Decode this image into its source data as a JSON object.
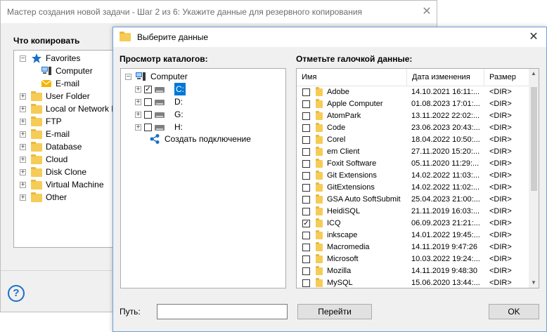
{
  "wizard": {
    "title": "Мастер создания новой задачи - Шаг 2 из 6: Укажите данные для резервного копирования",
    "close_glyph": "✕",
    "section_label": "Что копировать",
    "help_glyph": "?",
    "tree": [
      {
        "label": "Favorites",
        "icon": "star-icon",
        "expander": "−"
      },
      {
        "label": "Computer",
        "icon": "computer-icon"
      },
      {
        "label": "E-mail",
        "icon": "mail-icon"
      },
      {
        "label": "User Folder",
        "icon": "folder-icon",
        "expander": "+"
      },
      {
        "label": "Local or Network D",
        "icon": "folder-icon",
        "expander": "+"
      },
      {
        "label": "FTP",
        "icon": "folder-icon",
        "expander": "+"
      },
      {
        "label": "E-mail",
        "icon": "folder-icon",
        "expander": "+"
      },
      {
        "label": "Database",
        "icon": "folder-icon",
        "expander": "+"
      },
      {
        "label": "Cloud",
        "icon": "folder-icon",
        "expander": "+"
      },
      {
        "label": "Disk Clone",
        "icon": "folder-icon",
        "expander": "+"
      },
      {
        "label": "Virtual Machine",
        "icon": "folder-icon",
        "expander": "+"
      },
      {
        "label": "Other",
        "icon": "folder-icon",
        "expander": "+"
      }
    ]
  },
  "dialog": {
    "title": "Выберите данные",
    "close_glyph": "✕",
    "browse_label": "Просмотр каталогов:",
    "check_label": "Отметьте галочкой данные:",
    "dir_tree": {
      "root": "Computer",
      "drives": [
        {
          "label": "C:",
          "checked": true,
          "selected": true
        },
        {
          "label": "D:",
          "checked": false
        },
        {
          "label": "G:",
          "checked": false
        },
        {
          "label": "H:",
          "checked": false
        }
      ],
      "create_connection": "Создать подключение"
    },
    "columns": {
      "name": "Имя",
      "modified": "Дата изменения",
      "size": "Размер"
    },
    "files": [
      {
        "name": "Adobe",
        "date": "14.10.2021 16:11:...",
        "size": "<DIR>",
        "checked": false
      },
      {
        "name": "Apple Computer",
        "date": "01.08.2023 17:01:...",
        "size": "<DIR>",
        "checked": false
      },
      {
        "name": "AtomPark",
        "date": "13.11.2022 22:02:...",
        "size": "<DIR>",
        "checked": false
      },
      {
        "name": "Code",
        "date": "23.06.2023 20:43:...",
        "size": "<DIR>",
        "checked": false
      },
      {
        "name": "Corel",
        "date": "18.04.2022 10:50:...",
        "size": "<DIR>",
        "checked": false
      },
      {
        "name": "em Client",
        "date": "27.11.2020 15:20:...",
        "size": "<DIR>",
        "checked": false
      },
      {
        "name": "Foxit Software",
        "date": "05.11.2020 11:29:...",
        "size": "<DIR>",
        "checked": false
      },
      {
        "name": "Git Extensions",
        "date": "14.02.2022 11:03:...",
        "size": "<DIR>",
        "checked": false
      },
      {
        "name": "GitExtensions",
        "date": "14.02.2022 11:02:...",
        "size": "<DIR>",
        "checked": false
      },
      {
        "name": "GSA Auto SoftSubmit",
        "date": "25.04.2023 21:00:...",
        "size": "<DIR>",
        "checked": false
      },
      {
        "name": "HeidiSQL",
        "date": "21.11.2019 16:03:...",
        "size": "<DIR>",
        "checked": false
      },
      {
        "name": "ICQ",
        "date": "06.09.2023 21:21:...",
        "size": "<DIR>",
        "checked": true
      },
      {
        "name": "inkscape",
        "date": "14.01.2022 19:45:...",
        "size": "<DIR>",
        "checked": false
      },
      {
        "name": "Macromedia",
        "date": "14.11.2019 9:47:26",
        "size": "<DIR>",
        "checked": false
      },
      {
        "name": "Microsoft",
        "date": "10.03.2022 19:24:...",
        "size": "<DIR>",
        "checked": false
      },
      {
        "name": "Mozilla",
        "date": "14.11.2019 9:48:30",
        "size": "<DIR>",
        "checked": false
      },
      {
        "name": "MySQL",
        "date": "15.06.2020 13:44:...",
        "size": "<DIR>",
        "checked": false
      }
    ],
    "paths_label": "Путь:",
    "paths_value": "",
    "go_label": "Перейти",
    "ok_label": "OK",
    "check_glyph": "✓"
  },
  "colors": {
    "accent": "#0078d7",
    "folder": "#f6cc57",
    "star": "#1b6fc7"
  }
}
